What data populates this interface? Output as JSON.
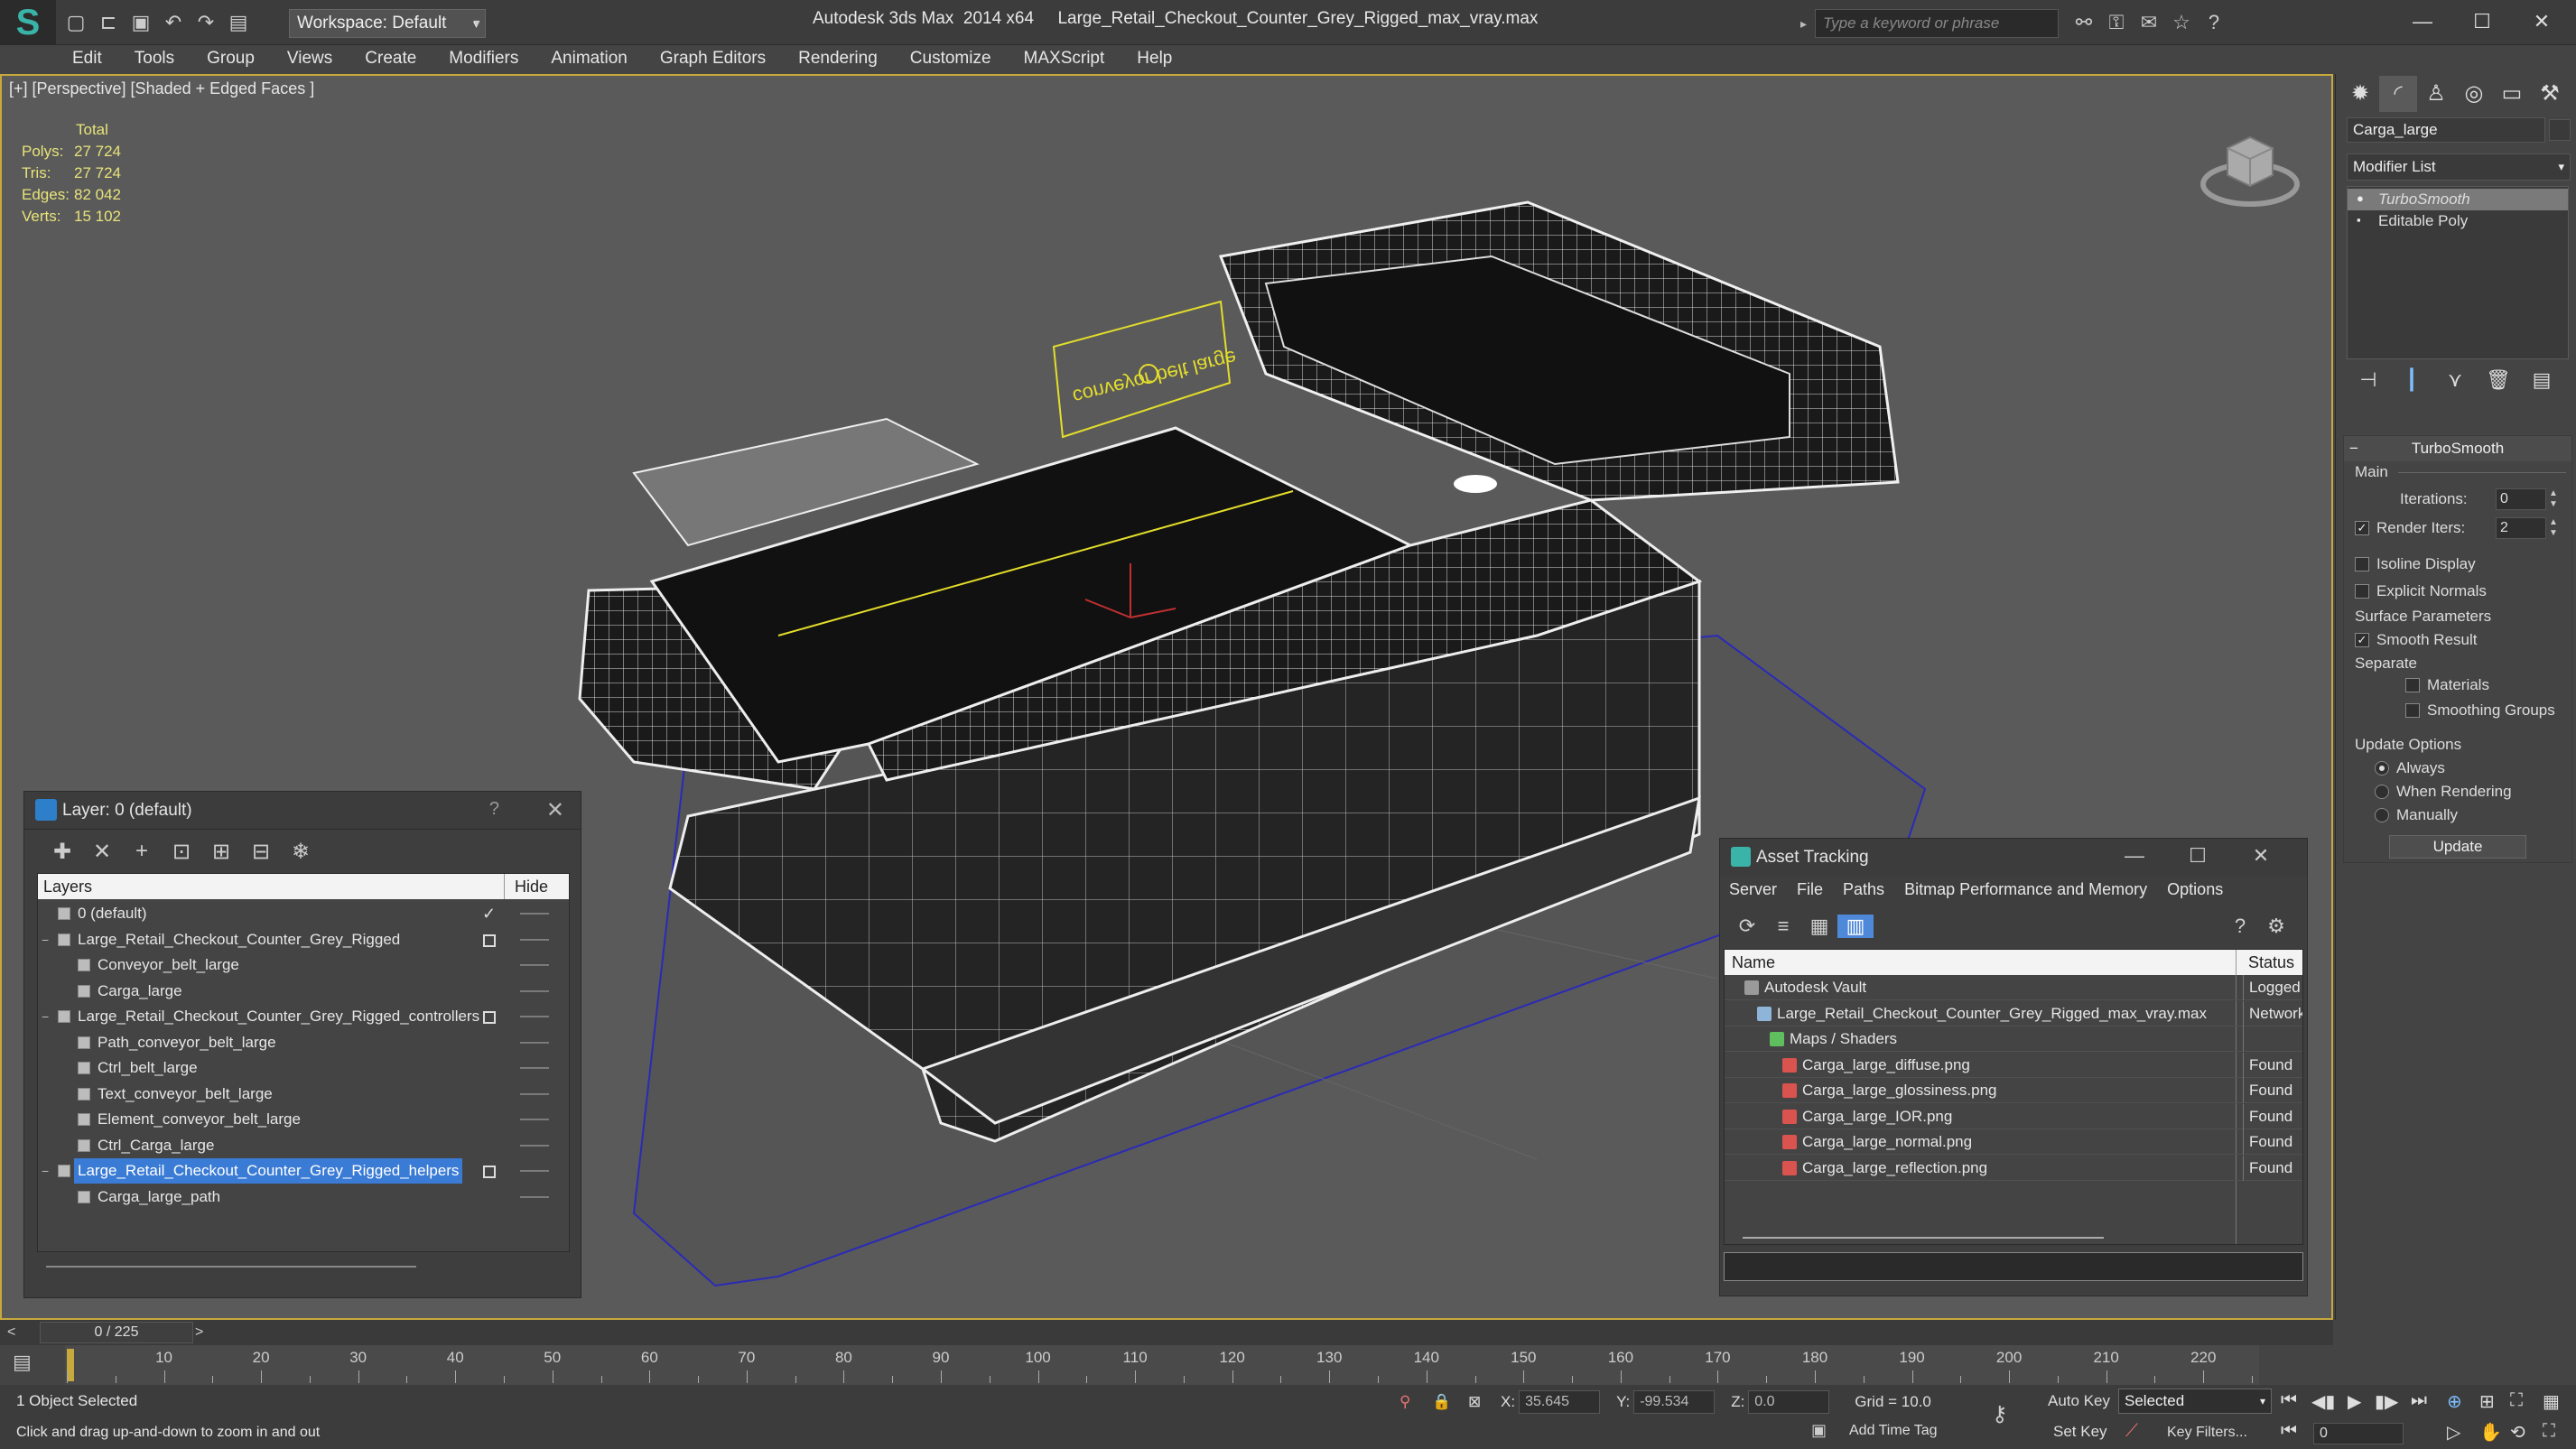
{
  "titlebar": {
    "app": "Autodesk 3ds Max",
    "version": "2014 x64",
    "filename": "Large_Retail_Checkout_Counter_Grey_Rigged_max_vray.max",
    "workspace": "Workspace: Default",
    "search_placeholder": "Type a keyword or phrase"
  },
  "menu": [
    "Edit",
    "Tools",
    "Group",
    "Views",
    "Create",
    "Modifiers",
    "Animation",
    "Graph Editors",
    "Rendering",
    "Customize",
    "MAXScript",
    "Help"
  ],
  "viewport": {
    "label": "[+] [Perspective] [Shaded + Edged Faces ]",
    "stats": {
      "header": "Total",
      "rows": [
        {
          "label": "Polys:",
          "value": "27 724"
        },
        {
          "label": "Tris:",
          "value": "27 724"
        },
        {
          "label": "Edges:",
          "value": "82 042"
        },
        {
          "label": "Verts:",
          "value": "15 102"
        }
      ]
    },
    "sign_text": "conveyor belt large"
  },
  "layer_window": {
    "title": "Layer: 0 (default)",
    "help": "?",
    "col_layers": "Layers",
    "col_hide": "Hide",
    "rows": [
      {
        "name": "0 (default)",
        "level": 0,
        "type": "layer",
        "mark": "check",
        "selected": false
      },
      {
        "name": "Large_Retail_Checkout_Counter_Grey_Rigged",
        "level": 0,
        "type": "layer",
        "mark": "box",
        "selected": false,
        "expand": "−"
      },
      {
        "name": "Conveyor_belt_large",
        "level": 1,
        "type": "object",
        "mark": "",
        "selected": false
      },
      {
        "name": "Carga_large",
        "level": 1,
        "type": "object",
        "mark": "",
        "selected": false
      },
      {
        "name": "Large_Retail_Checkout_Counter_Grey_Rigged_controllers",
        "level": 0,
        "type": "layer",
        "mark": "box",
        "selected": false,
        "expand": "−"
      },
      {
        "name": "Path_conveyor_belt_large",
        "level": 1,
        "type": "object",
        "mark": "",
        "selected": false
      },
      {
        "name": "Ctrl_belt_large",
        "level": 1,
        "type": "object",
        "mark": "",
        "selected": false
      },
      {
        "name": "Text_conveyor_belt_large",
        "level": 1,
        "type": "object",
        "mark": "",
        "selected": false
      },
      {
        "name": "Element_conveyor_belt_large",
        "level": 1,
        "type": "object",
        "mark": "",
        "selected": false
      },
      {
        "name": "Ctrl_Carga_large",
        "level": 1,
        "type": "object",
        "mark": "",
        "selected": false
      },
      {
        "name": "Large_Retail_Checkout_Counter_Grey_Rigged_helpers",
        "level": 0,
        "type": "layer",
        "mark": "box",
        "selected": true,
        "expand": "−"
      },
      {
        "name": "Carga_large_path",
        "level": 1,
        "type": "object",
        "mark": "",
        "selected": false
      }
    ]
  },
  "asset_window": {
    "title": "Asset Tracking",
    "menu": [
      "Server",
      "File",
      "Paths",
      "Bitmap Performance and Memory",
      "Options"
    ],
    "col_name": "Name",
    "col_status": "Status",
    "rows": [
      {
        "name": "Autodesk Vault",
        "status": "Logged",
        "level": 1,
        "icon": "#9a9a9a"
      },
      {
        "name": "Large_Retail_Checkout_Counter_Grey_Rigged_max_vray.max",
        "status": "Network",
        "level": 2,
        "icon": "#8fb4d9"
      },
      {
        "name": "Maps / Shaders",
        "status": "",
        "level": 3,
        "icon": "#5fbf5f"
      },
      {
        "name": "Carga_large_diffuse.png",
        "status": "Found",
        "level": 4,
        "icon": "#d9534f"
      },
      {
        "name": "Carga_large_glossiness.png",
        "status": "Found",
        "level": 4,
        "icon": "#d9534f"
      },
      {
        "name": "Carga_large_IOR.png",
        "status": "Found",
        "level": 4,
        "icon": "#d9534f"
      },
      {
        "name": "Carga_large_normal.png",
        "status": "Found",
        "level": 4,
        "icon": "#d9534f"
      },
      {
        "name": "Carga_large_reflection.png",
        "status": "Found",
        "level": 4,
        "icon": "#d9534f"
      }
    ]
  },
  "command_panel": {
    "object_name": "Carga_large",
    "modifier_list": "Modifier List",
    "stack": [
      {
        "name": "TurboSmooth",
        "active": true
      },
      {
        "name": "Editable Poly",
        "active": false
      }
    ],
    "rollout_title": "TurboSmooth",
    "main_group": "Main",
    "iterations_label": "Iterations:",
    "iterations_value": "0",
    "render_iters_label": "Render Iters:",
    "render_iters_value": "2",
    "render_iters_checked": true,
    "isoline": "Isoline Display",
    "explicit_normals": "Explicit Normals",
    "surface_group": "Surface Parameters",
    "smooth_result": "Smooth Result",
    "separate_label": "Separate",
    "materials": "Materials",
    "smoothing_groups": "Smoothing Groups",
    "update_group": "Update Options",
    "always": "Always",
    "when_rendering": "When Rendering",
    "manually": "Manually",
    "update_button": "Update"
  },
  "timeline": {
    "frame": "0 / 225",
    "prev": "<",
    "next": ">",
    "ticks": [
      0,
      10,
      20,
      30,
      40,
      50,
      60,
      70,
      80,
      90,
      100,
      110,
      120,
      130,
      140,
      150,
      160,
      170,
      180,
      190,
      200,
      210,
      220
    ]
  },
  "status": {
    "selection": "1 Object Selected",
    "hint": "Click and drag up-and-down to zoom in and out",
    "x_label": "X:",
    "x_value": "35.645",
    "y_label": "Y:",
    "y_value": "-99.534",
    "z_label": "Z:",
    "z_value": "0.0",
    "grid": "Grid = 10.0",
    "add_time_tag": "Add Time Tag",
    "auto_key": "Auto Key",
    "selected_set": "Selected",
    "set_key": "Set Key",
    "key_filters": "Key Filters...",
    "frame_value": "0"
  },
  "colors": {
    "viewport_border": "#c8a93d",
    "selection_blue": "#3a7bd5",
    "stats_text": "#e8e37a"
  }
}
